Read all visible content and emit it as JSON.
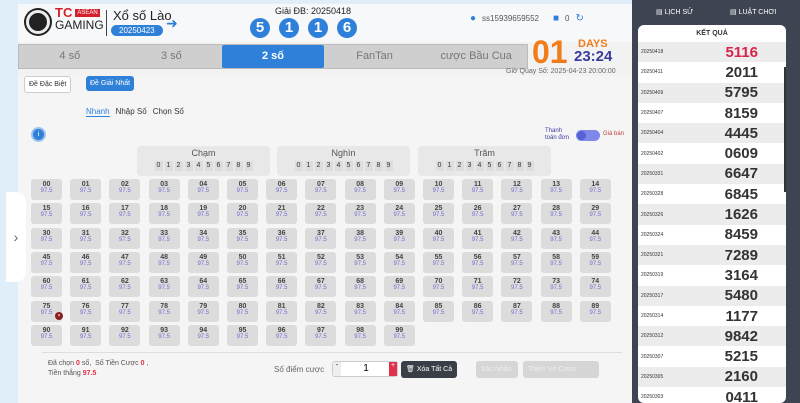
{
  "header": {
    "brand_top": "TC",
    "brand_badge": "ASEAN",
    "brand_bottom": "GAMING",
    "game_title": "Xổ số Lào",
    "game_date": "20250423",
    "special_prize_label": "Giải ĐB: 20250418",
    "special_prize_digits": [
      "5",
      "1",
      "1",
      "6"
    ],
    "username": "ss15939659552",
    "balance": "0"
  },
  "tabs": [
    {
      "label": "4 số"
    },
    {
      "label": "3 số"
    },
    {
      "label": "2 số",
      "active": true
    },
    {
      "label": "FanTan"
    },
    {
      "label": "cược Bầu Cua"
    }
  ],
  "countdown": {
    "days": "01",
    "days_label": "DAYS",
    "time": "23:24",
    "draw_time": "Giờ Quay Số: 2025-04-23 20:00:00"
  },
  "bet_types": {
    "special": "Đề Đặc Biệt",
    "first": "Đề Giải Nhất"
  },
  "subtabs": [
    "Nhanh",
    "Nhập Số",
    "Chọn Số"
  ],
  "toggle": {
    "left": "Thanh toán đơn",
    "right": "Giá bán"
  },
  "groups": [
    {
      "title": "Chạm"
    },
    {
      "title": "Nghìn"
    },
    {
      "title": "Trăm"
    }
  ],
  "digits": [
    "0",
    "1",
    "2",
    "3",
    "4",
    "5",
    "6",
    "7",
    "8",
    "9"
  ],
  "odds": "97.5",
  "footer": {
    "selected_prefix": "Đã chọn",
    "selected_count": "0",
    "selected_suffix": "số,",
    "bet_amount_label": "Số Tiền Cược",
    "bet_amount": "0",
    "win_label": "Tiền thắng",
    "win_amount": "97.5",
    "points_label": "Số điểm cược",
    "points_value": "1",
    "minus": "-",
    "plus": "+",
    "clear_all": "Xóa Tất Cả",
    "confirm": "Xác Nhận",
    "add_ticket": "Thêm Vé Cược"
  },
  "right": {
    "history": "LỊCH SỬ",
    "rules": "LUẬT CHƠI",
    "results_title": "KẾT QUẢ",
    "results": [
      [
        "20250418",
        "5116"
      ],
      [
        "20250411",
        "2011"
      ],
      [
        "20250409",
        "5795"
      ],
      [
        "20250407",
        "8159"
      ],
      [
        "20250404",
        "4445"
      ],
      [
        "20250402",
        "0609"
      ],
      [
        "20250331",
        "6647"
      ],
      [
        "20250328",
        "6845"
      ],
      [
        "20250326",
        "1626"
      ],
      [
        "20250324",
        "8459"
      ],
      [
        "20250321",
        "7289"
      ],
      [
        "20250319",
        "3164"
      ],
      [
        "20250317",
        "5480"
      ],
      [
        "20250314",
        "1177"
      ],
      [
        "20250312",
        "9842"
      ],
      [
        "20250307",
        "5215"
      ],
      [
        "20250305",
        "2160"
      ],
      [
        "20250303",
        "0411"
      ]
    ]
  },
  "colors": {
    "accent": "#2f80d9",
    "countdown": "#f07c1b",
    "highlight": "#d8234a",
    "sidebar": "#3f4452"
  }
}
